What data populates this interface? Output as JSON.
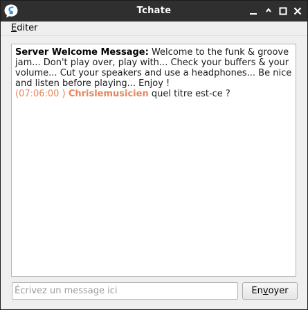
{
  "window": {
    "title": "Tchate"
  },
  "menubar": {
    "items": [
      {
        "label": "Editer",
        "mnemonic": "E"
      }
    ]
  },
  "chat": {
    "welcome_label": "Server Welcome Message:",
    "welcome_text": "Welcome to the funk & groove jam... Don't play over, play with... Check your buffers & your volume... Cut your speakers and use a headphones... Be nice and listen before playing... Enjoy !",
    "messages": [
      {
        "timestamp": "(07:06:00 )",
        "user": "Chrislemusicien",
        "text": "quel titre est-ce ?"
      }
    ]
  },
  "composer": {
    "placeholder": "Écrivez un message ici",
    "send_label": "Envoyer"
  },
  "colors": {
    "titlebar": "#2f2f2f",
    "accent": "#e8865b",
    "window_bg": "#efefef"
  },
  "icons": [
    "app-logo-icon",
    "minimize-icon",
    "maximize-icon",
    "close-icon"
  ]
}
